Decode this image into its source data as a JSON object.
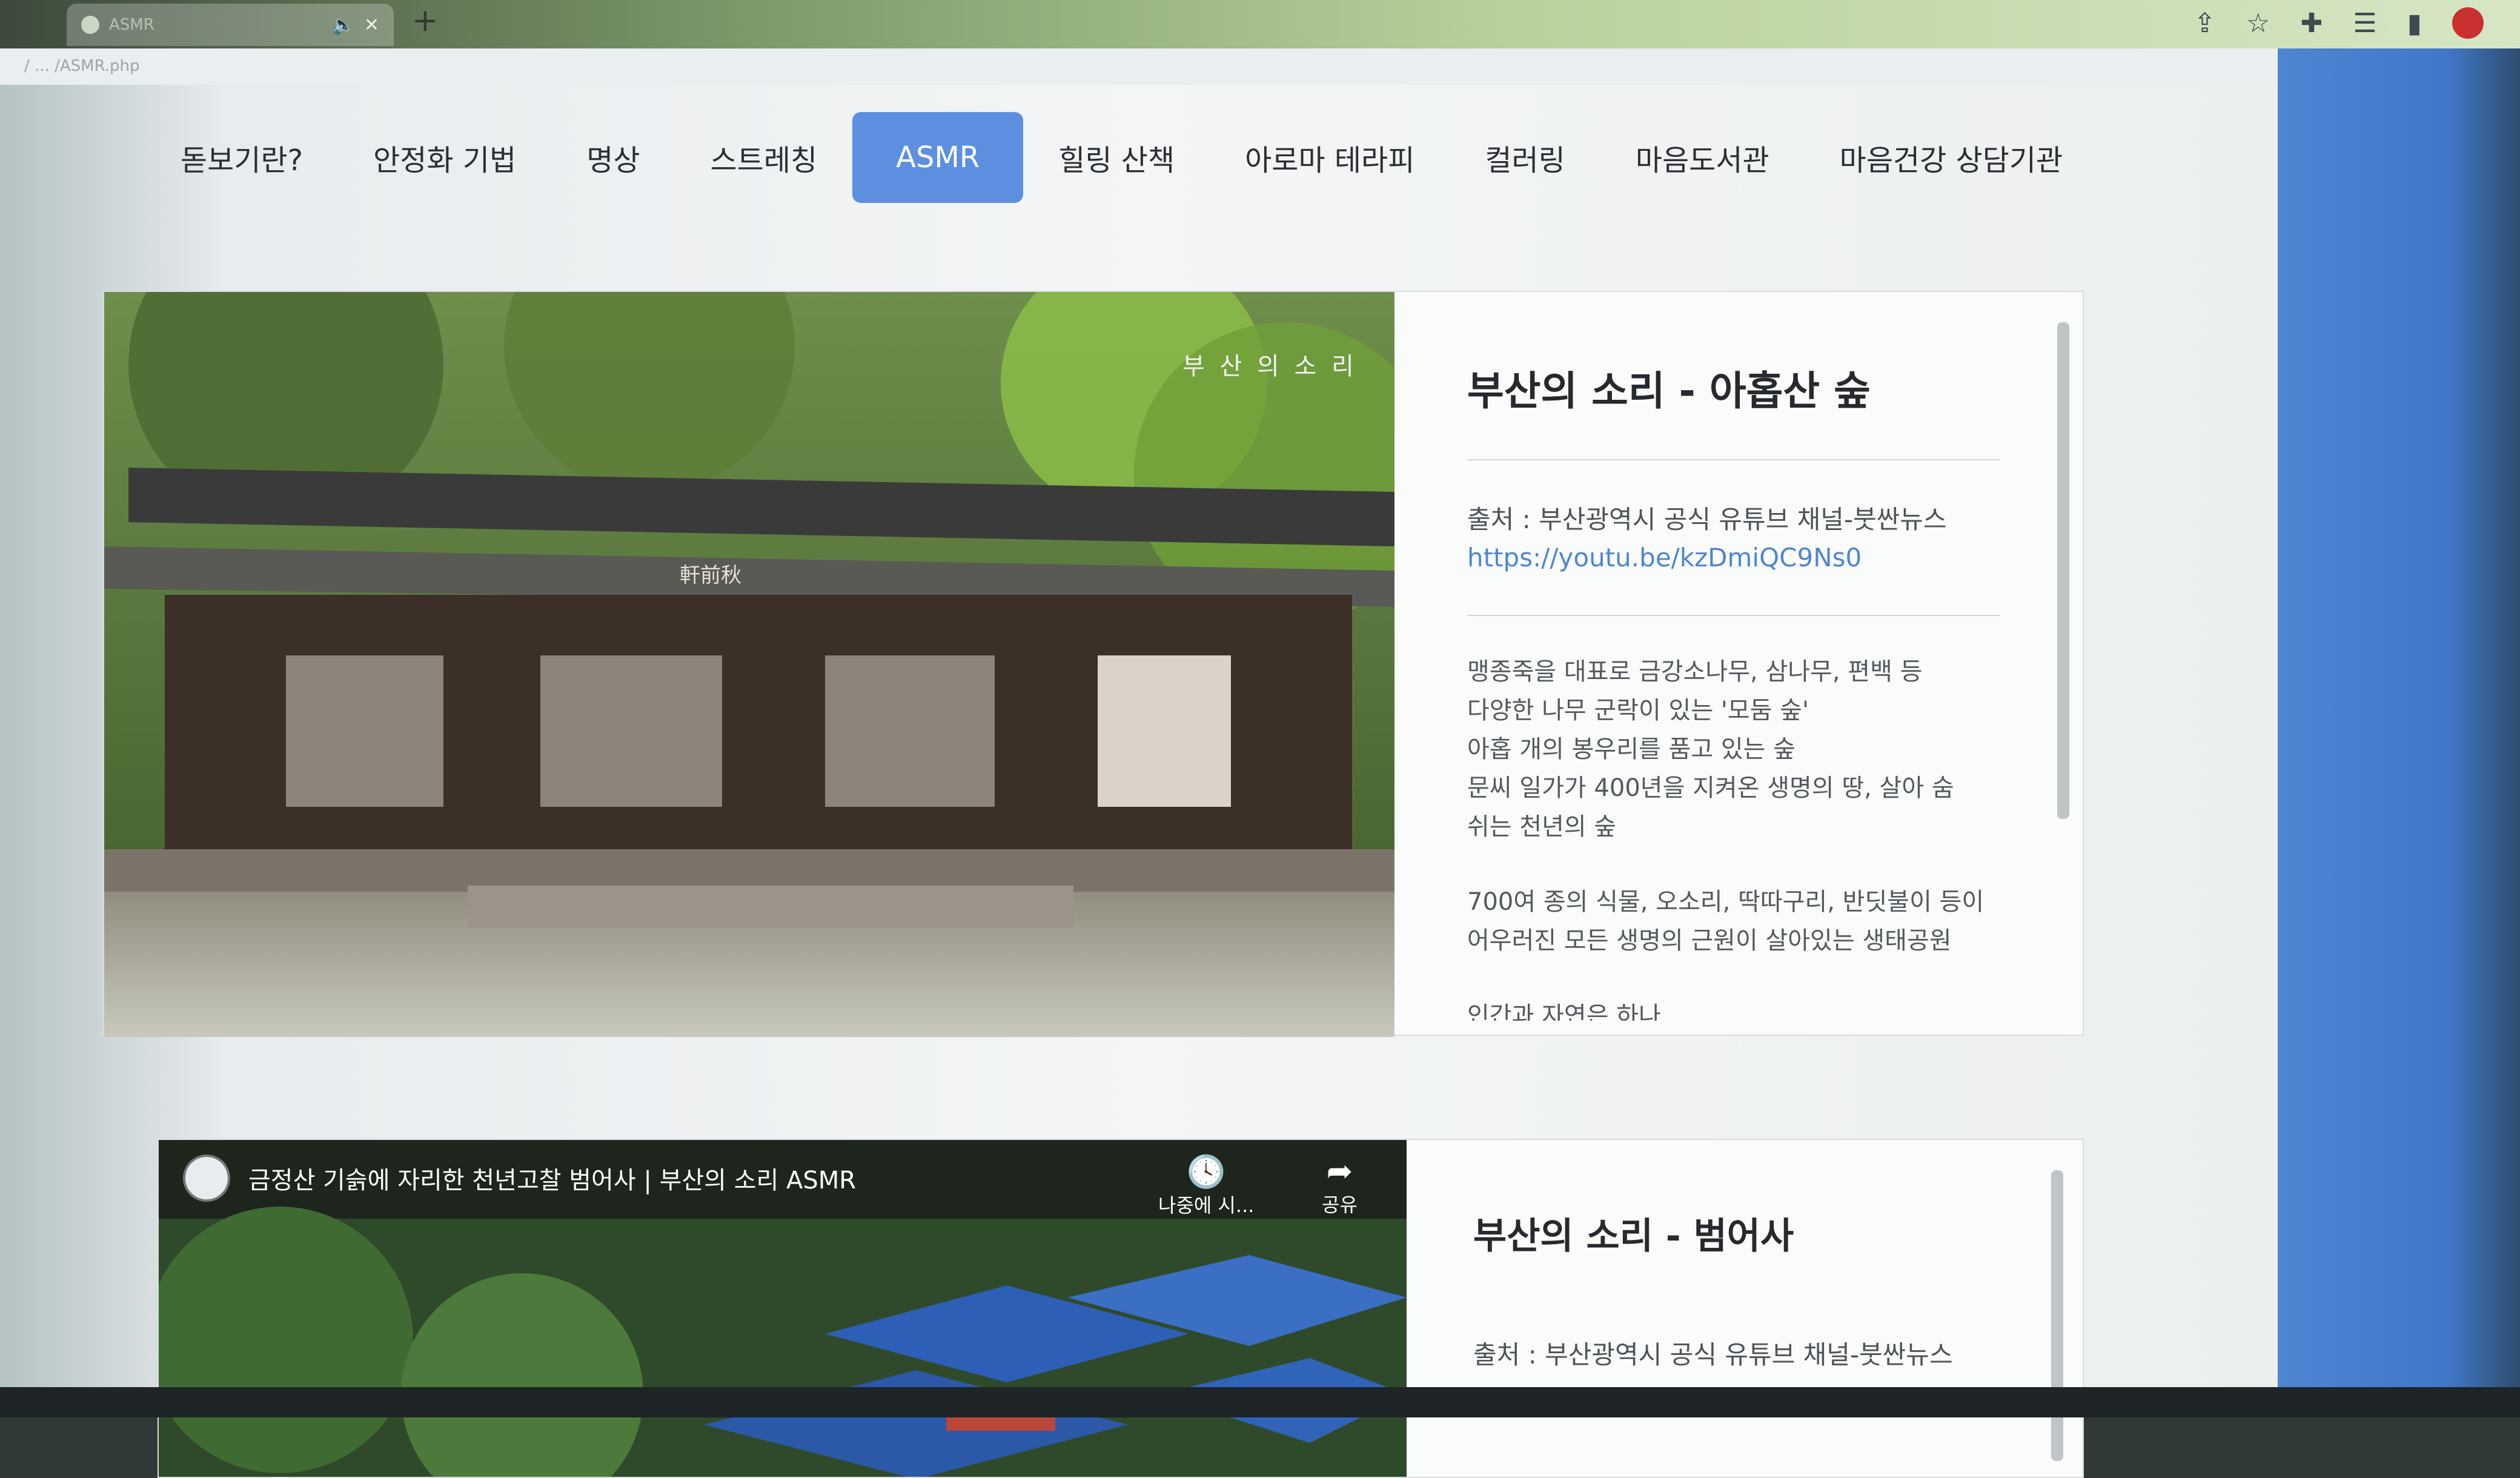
{
  "browser": {
    "tab_title": "ASMR",
    "url": "/ ... /ASMR.php",
    "new_tab": "+"
  },
  "nav": {
    "items": [
      {
        "label": "돋보기란?"
      },
      {
        "label": "안정화 기법"
      },
      {
        "label": "명상"
      },
      {
        "label": "스트레칭"
      },
      {
        "label": "ASMR",
        "active": true
      },
      {
        "label": "힐링 산책"
      },
      {
        "label": "아로마 테라피"
      },
      {
        "label": "컬러링"
      },
      {
        "label": "마음도서관"
      },
      {
        "label": "마음건강 상담기관"
      }
    ]
  },
  "card1": {
    "image_caption": "부 산 의 소 리",
    "building_sign": "軒前秋",
    "title": "부산의 소리 - 아홉산 숲",
    "source": "출처 : 부산광역시 공식 유튜브 채널-붓싼뉴스",
    "link": "https://youtu.be/kzDmiQC9Ns0",
    "desc1": "맹종죽을 대표로 금강소나무, 삼나무, 편백 등\n다양한 나무 군락이 있는 '모둠 숲'\n아홉 개의 봉우리를 품고 있는 숲\n문씨 일가가 400년을 지켜온 생명의 땅, 살아 숨\n쉬는 천년의 숲",
    "desc2": "700여 종의 식물, 오소리, 딱따구리, 반딧불이 등이\n어우러진 모든 생명의 근원이 살아있는 생태공원",
    "desc3": "인간과 자연은 하나"
  },
  "card2": {
    "video_title": "금정산 기슭에 자리한 천년고찰 범어사 | 부산의 소리 ASMR",
    "watch_later": "나중에 시...",
    "share": "공유",
    "title": "부산의 소리 - 범어사",
    "source": "출처 : 부산광역시 공식 유튜브 채널-붓싼뉴스"
  },
  "colors": {
    "accent": "#5d8fe0",
    "link": "#4f86cf",
    "side_blue": "#3f78c8"
  }
}
